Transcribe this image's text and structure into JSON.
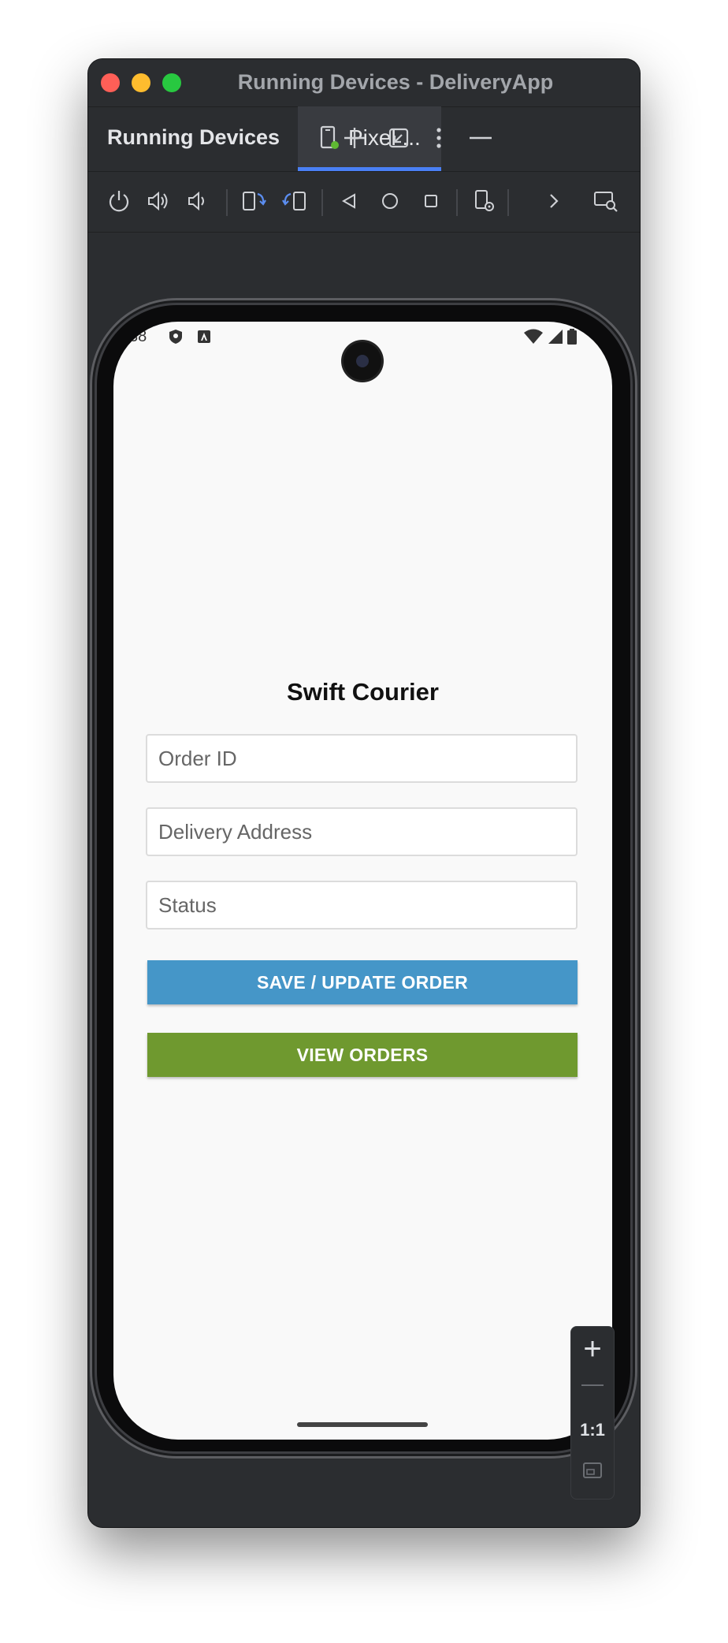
{
  "window": {
    "title": "Running Devices - DeliveryApp"
  },
  "tool_window": {
    "title": "Running Devices",
    "tab_label": "Pixel ...",
    "header_icons": [
      "add-icon",
      "restore-icon",
      "more-vertical-icon",
      "minimize-icon"
    ]
  },
  "toolbar": {
    "icons": [
      "power-icon",
      "volume-up-icon",
      "volume-down-icon",
      "rotate-left-icon",
      "rotate-right-icon",
      "back-icon",
      "home-icon",
      "overview-icon",
      "device-settings-icon",
      "chevron-right-icon",
      "screen-inspect-icon"
    ]
  },
  "device": {
    "status_time": "38"
  },
  "app": {
    "title": "Swift Courier",
    "order_id_placeholder": "Order ID",
    "address_placeholder": "Delivery Address",
    "status_placeholder": "Status",
    "save_button": "SAVE / UPDATE ORDER",
    "view_button": "VIEW ORDERS",
    "save_color": "#4596c8",
    "view_color": "#6f992f"
  },
  "zoom": {
    "plus": "+",
    "minus": "—",
    "reset": "1:1"
  }
}
